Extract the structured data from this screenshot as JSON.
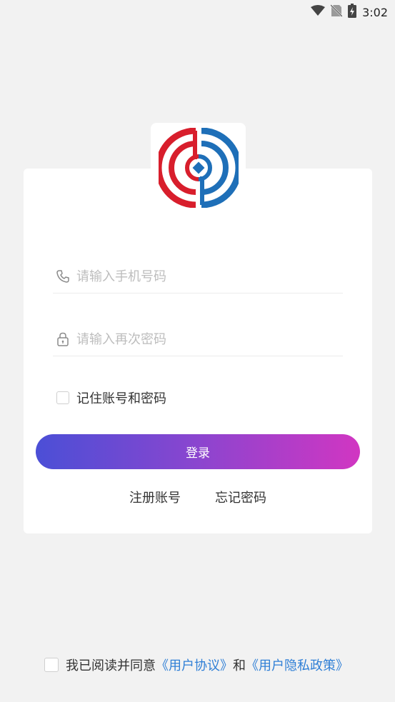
{
  "status_bar": {
    "time": "3:02",
    "icons": [
      "wifi-icon",
      "no-sim-icon",
      "battery-charging-icon"
    ]
  },
  "logo": {
    "icon": "app-logo-icon",
    "colors": {
      "red": "#d81e2c",
      "blue": "#1e6fb8"
    }
  },
  "form": {
    "phone_placeholder": "请输入手机号码",
    "phone_icon": "phone-icon",
    "password_placeholder": "请输入再次密码",
    "password_icon": "lock-icon",
    "remember_label": "记住账号和密码",
    "login_label": "登录",
    "register_label": "注册账号",
    "forgot_label": "忘记密码"
  },
  "agreement": {
    "prefix": "我已阅读并同意",
    "user_agreement": "《用户协议》",
    "and": "和",
    "privacy_policy": "《用户隐私政策》"
  },
  "colors": {
    "background": "#f2f2f2",
    "card": "#ffffff",
    "gradient_start": "#4b4fd6",
    "gradient_end": "#d136c2",
    "link": "#2f7fd6"
  }
}
